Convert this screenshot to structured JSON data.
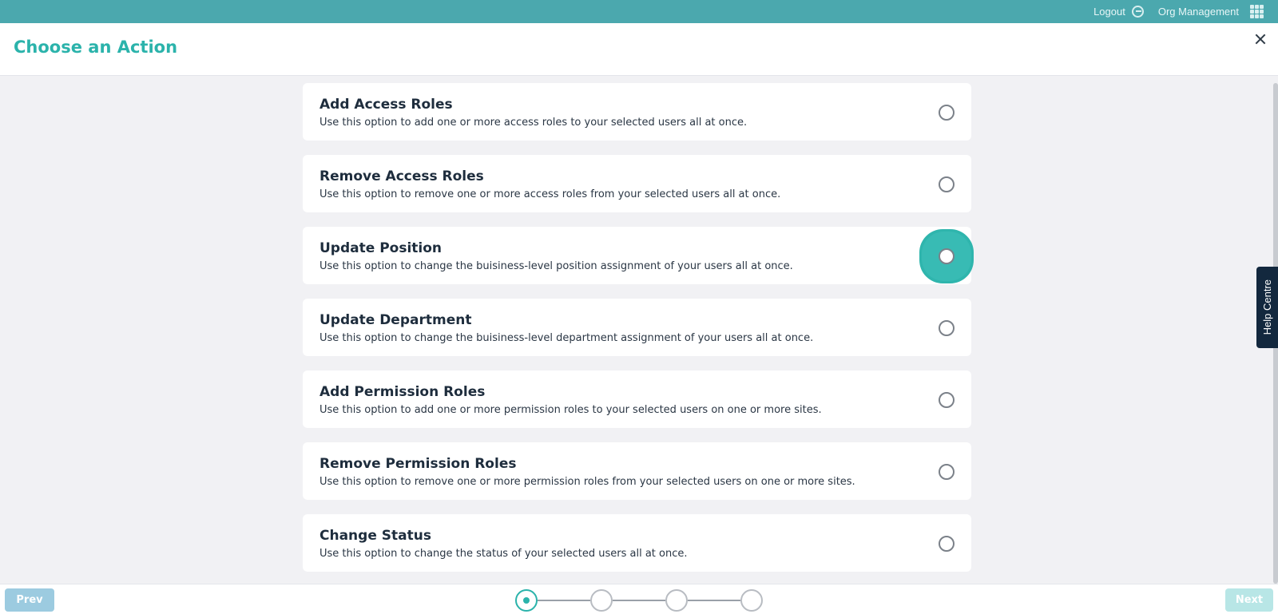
{
  "topbar": {
    "logout_label": "Logout",
    "org_label": "Org Management"
  },
  "header": {
    "title": "Choose an Action"
  },
  "actions": [
    {
      "title": "Add Access Roles",
      "description": "Use this option to add one or more access roles to your selected users all at once."
    },
    {
      "title": "Remove Access Roles",
      "description": "Use this option to remove one or more access roles from your selected users all at once."
    },
    {
      "title": "Update Position",
      "description": "Use this option to change the buisiness-level position assignment of your users all at once."
    },
    {
      "title": "Update Department",
      "description": "Use this option to change the buisiness-level department assignment of your users all at once."
    },
    {
      "title": "Add Permission Roles",
      "description": "Use this option to add one or more permission roles to your selected users on one or more sites."
    },
    {
      "title": "Remove Permission Roles",
      "description": "Use this option to remove one or more permission roles from your selected users on one or more sites."
    },
    {
      "title": "Change Status",
      "description": "Use this option to change the status of your selected users all at once."
    }
  ],
  "help_tab": {
    "label": "Help Centre"
  },
  "footer": {
    "prev_label": "Prev",
    "next_label": "Next",
    "steps_total": 4,
    "current_step": 1
  },
  "colors": {
    "topbar": "#4ba8ae",
    "accent": "#2bb3ab",
    "help_tab": "#13283e"
  }
}
